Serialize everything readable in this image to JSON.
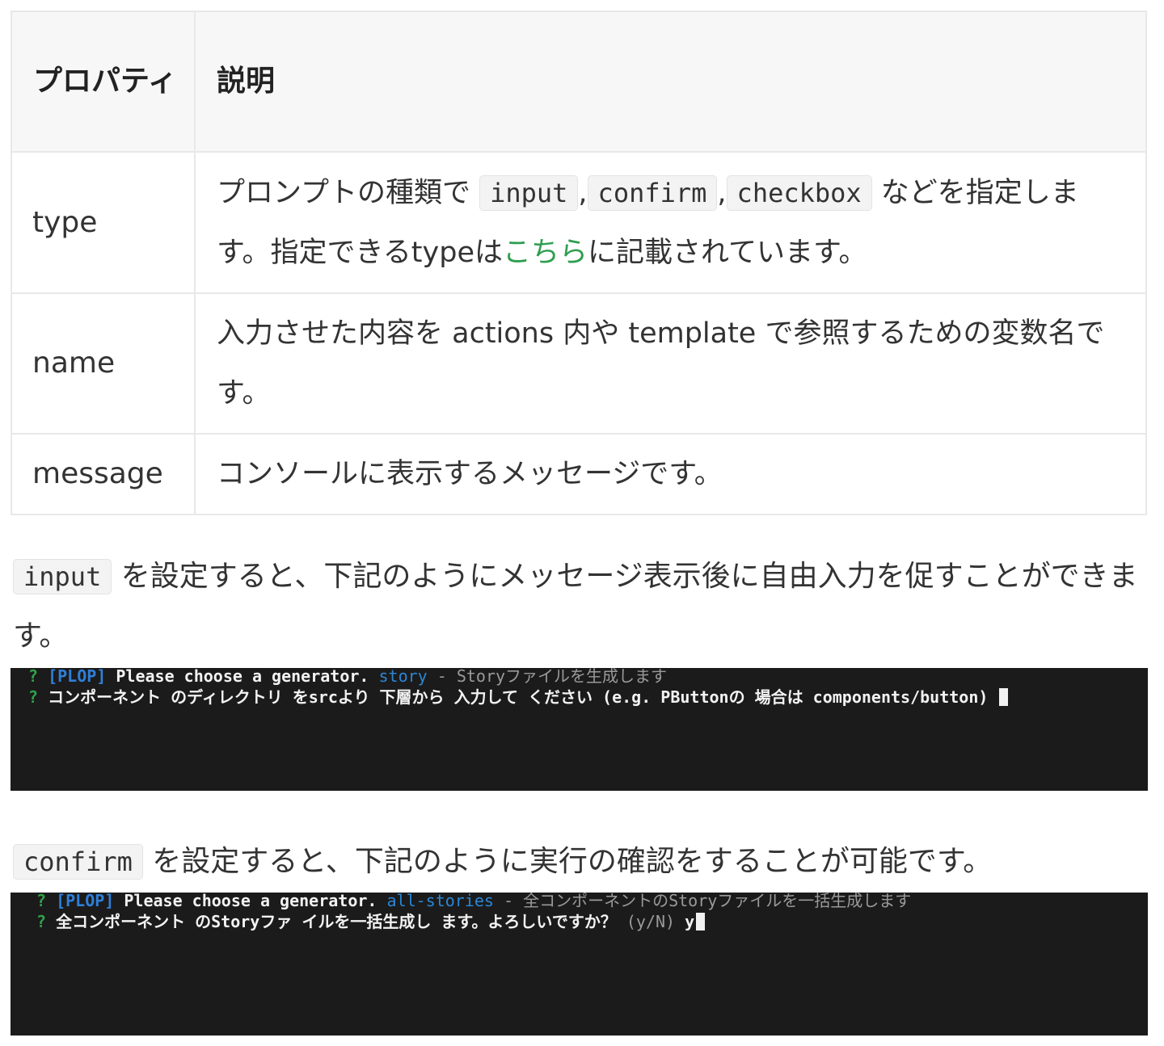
{
  "table": {
    "header": {
      "property": "プロパティ",
      "description": "説明"
    },
    "rows": [
      {
        "property": "type",
        "desc_before": "プロンプトの種類で ",
        "codes": [
          "input",
          "confirm",
          "checkbox"
        ],
        "comma": ",",
        "desc_after_codes": " などを指定します。指定できるtypeは",
        "link_text": "こちら",
        "desc_end": "に記載されています。"
      },
      {
        "property": "name",
        "description": "入力させた内容を actions 内や template で参照するための変数名です。"
      },
      {
        "property": "message",
        "description": "コンソールに表示するメッセージです。"
      }
    ]
  },
  "paragraphs": {
    "input": {
      "code": "input",
      "text": " を設定すると、下記のようにメッセージ表示後に自由入力を促すことができます。"
    },
    "confirm": {
      "code": "confirm",
      "text": " を設定すると、下記のように実行の確認をすることが可能です。"
    }
  },
  "terminals": {
    "input": {
      "line1": {
        "q": "?",
        "tag": "[PLOP]",
        "text": " Please choose a generator. ",
        "choice": "story",
        "rest": " - Storyファイルを生成します"
      },
      "line2": {
        "q": "?",
        "text": " コンポーネント のディレクトリ をsrcより 下層から 入力して ください (e.g. PButtonの 場合は components/button) "
      }
    },
    "confirm": {
      "line1": {
        "q": "?",
        "tag": "[PLOP]",
        "text": " Please choose a generator. ",
        "choice": "all-stories",
        "rest": " - 全コンポーネントのStoryファイルを一括生成します"
      },
      "line2": {
        "q": "?",
        "text": " 全コンポーネント のStoryファ イルを一括生成し ます。よろしいですか？ ",
        "hint": "(y/N)",
        "answer": " y"
      }
    }
  },
  "colors": {
    "link": "#2e9e4f",
    "terminal_bg": "#1b1b1b",
    "prompt_green": "#2ea34a",
    "plop_blue": "#2f7fd8",
    "choice_cyan": "#2a86d6"
  }
}
